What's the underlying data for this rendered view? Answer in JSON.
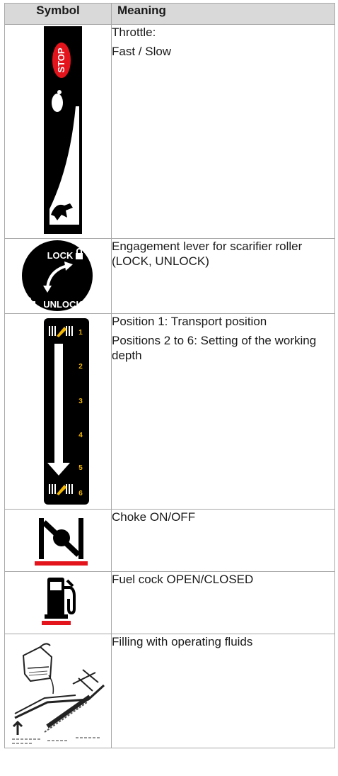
{
  "table": {
    "headers": {
      "symbol": "Symbol",
      "meaning": "Meaning"
    },
    "rows": [
      {
        "symbol_icon": "throttle-fast-slow-icon",
        "meaning": [
          "Throttle:",
          "Fast / Slow"
        ]
      },
      {
        "symbol_icon": "engagement-lever-lock-unlock-icon",
        "symbol_text": {
          "lock": "LOCK",
          "unlock": "UNLOCK"
        },
        "meaning": [
          "Engagement lever for scarifier roller (LOCK, UNLOCK)"
        ]
      },
      {
        "symbol_icon": "working-depth-scale-icon",
        "symbol_text": {
          "numbers": [
            "1",
            "2",
            "3",
            "4",
            "5",
            "6"
          ]
        },
        "meaning": [
          "Position 1: Transport position",
          "Positions 2 to 6: Setting of the working depth"
        ]
      },
      {
        "symbol_icon": "choke-icon",
        "meaning": [
          "Choke ON/OFF"
        ]
      },
      {
        "symbol_icon": "fuel-cock-icon",
        "meaning": [
          "Fuel cock OPEN/CLOSED"
        ]
      },
      {
        "symbol_icon": "filling-operating-fluids-icon",
        "meaning": [
          "Filling with operating fluids"
        ]
      }
    ],
    "stop_label": "STOP"
  }
}
